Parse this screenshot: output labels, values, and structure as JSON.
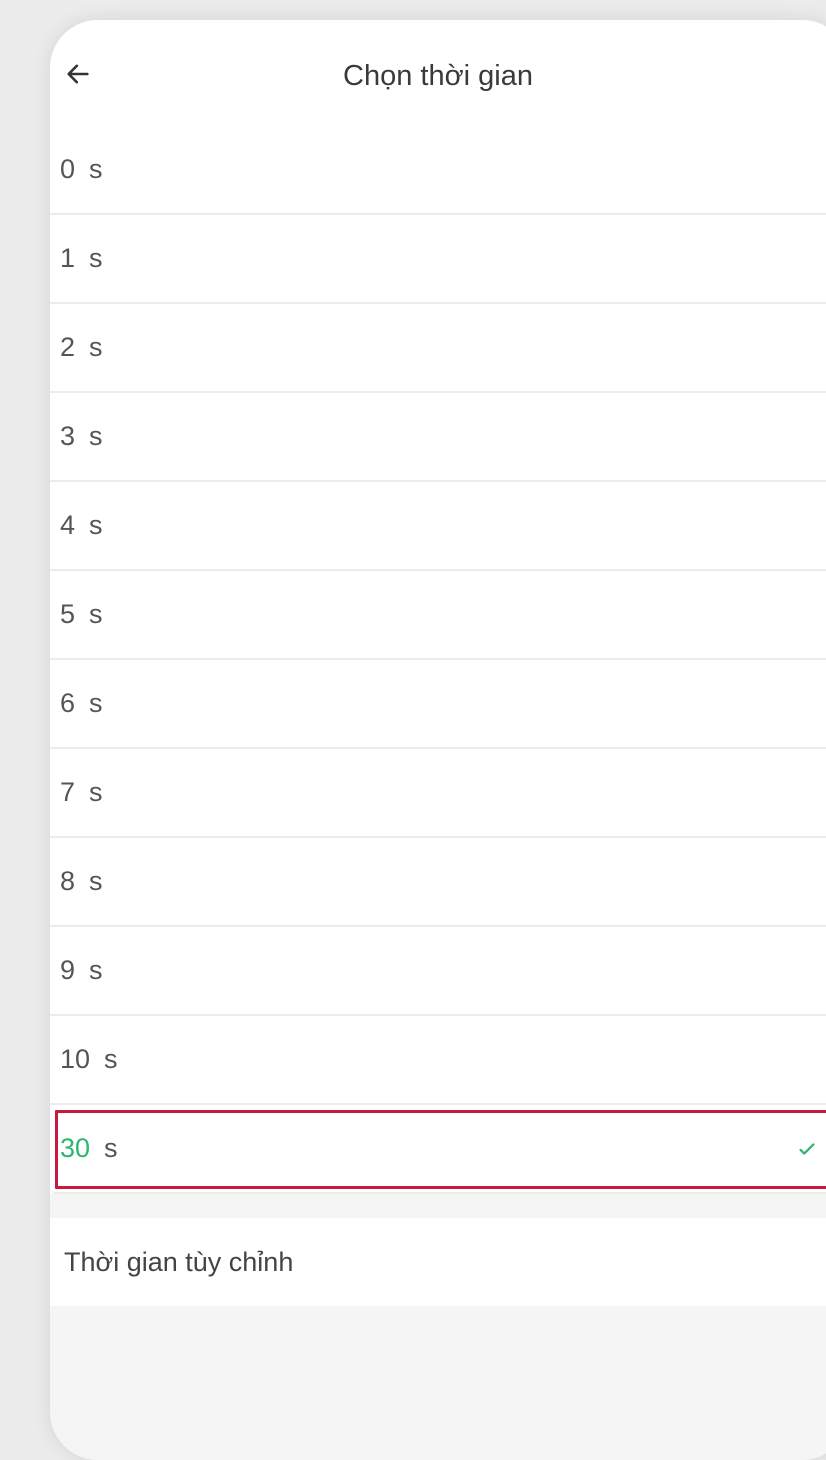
{
  "header": {
    "title": "Chọn thời gian"
  },
  "options": [
    {
      "value": "0",
      "unit": "s"
    },
    {
      "value": "1",
      "unit": "s"
    },
    {
      "value": "2",
      "unit": "s"
    },
    {
      "value": "3",
      "unit": "s"
    },
    {
      "value": "4",
      "unit": "s"
    },
    {
      "value": "5",
      "unit": "s"
    },
    {
      "value": "6",
      "unit": "s"
    },
    {
      "value": "7",
      "unit": "s"
    },
    {
      "value": "8",
      "unit": "s"
    },
    {
      "value": "9",
      "unit": "s"
    },
    {
      "value": "10",
      "unit": "s"
    },
    {
      "value": "30",
      "unit": "s"
    }
  ],
  "selected_index": 11,
  "custom_label": "Thời gian tùy chỉnh",
  "colors": {
    "selected_text": "#2db670",
    "highlight_box": "#c8193f"
  },
  "icons": {
    "back": "arrow-left-icon",
    "selected": "checkmark-icon"
  }
}
